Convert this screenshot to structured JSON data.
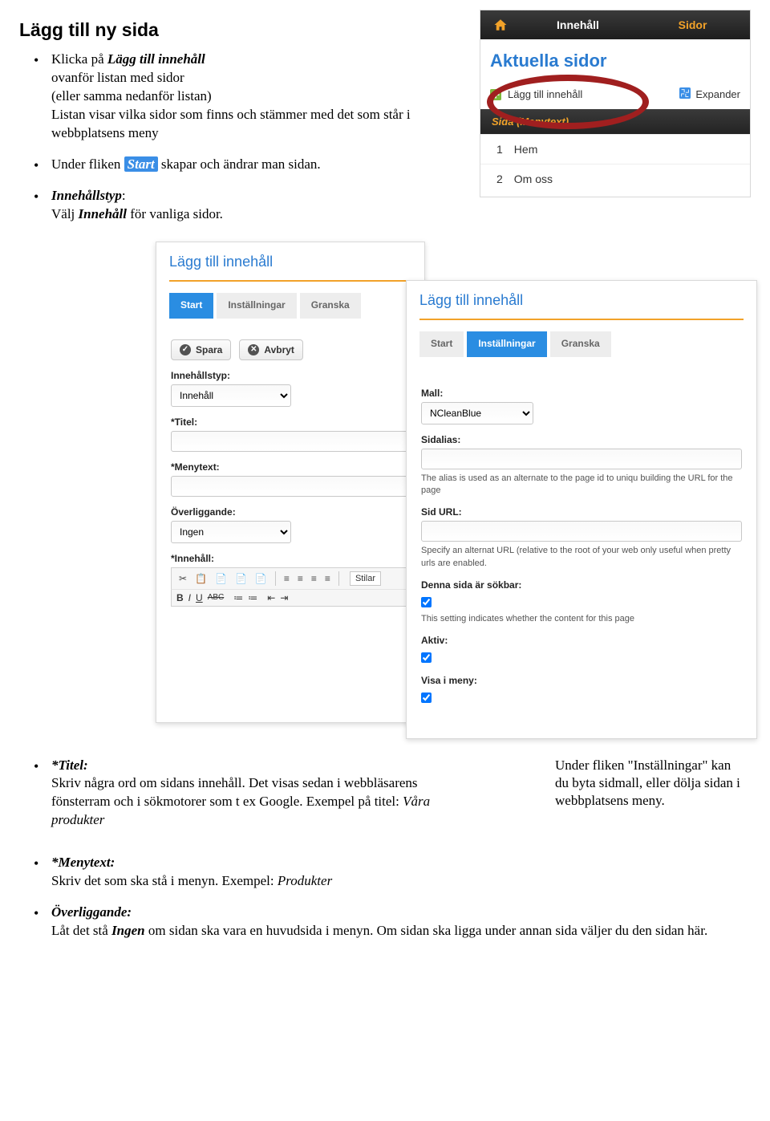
{
  "page_title": "Lägg till ny sida",
  "bullet1": {
    "lead_prefix": "Klicka på ",
    "lead_bi": "Lägg till innehåll",
    "line2": "ovanför listan med sidor",
    "line3": "(eller samma nedanför listan)",
    "line4": "Listan visar vilka sidor som finns och stämmer med det som står i webbplatsens meny"
  },
  "bullet2": {
    "prefix": "Under fliken ",
    "start": "Start",
    "suffix": " skapar och ändrar man sidan."
  },
  "bullet3": {
    "heading": "Innehållstyp",
    "line_prefix": "Välj ",
    "line_bi": "Innehåll",
    "line_suffix": " för vanliga sidor."
  },
  "nav": {
    "innehall": "Innehåll",
    "sidor": "Sidor",
    "section": "Aktuella sidor",
    "add_link": "Lägg till innehåll",
    "expand": "Expander",
    "dark_row": "Sida (Menytext)",
    "row1_num": "1",
    "row1_label": "Hem",
    "row2_num": "2",
    "row2_label": "Om oss"
  },
  "panel1": {
    "title": "Lägg till innehåll",
    "tab_start": "Start",
    "tab_settings": "Inställningar",
    "tab_review": "Granska",
    "save": "Spara",
    "cancel": "Avbryt",
    "lbl_type": "Innehållstyp:",
    "type_value": "Innehåll",
    "lbl_title": "*Titel:",
    "lbl_menu": "*Menytext:",
    "lbl_parent": "Överliggande:",
    "parent_value": "Ingen",
    "lbl_content": "*Innehåll:",
    "stilar": "Stilar"
  },
  "panel2": {
    "title": "Lägg till innehåll",
    "tab_start": "Start",
    "tab_settings": "Inställningar",
    "tab_review": "Granska",
    "lbl_mall": "Mall:",
    "mall_value": "NCleanBlue",
    "lbl_sidalias": "Sidalias:",
    "alias_help": "The alias is used as an alternate to the page id to uniqu building the URL for the page",
    "lbl_sidurl": "Sid URL:",
    "url_help": "Specify an alternat URL (relative to the root of your web only useful when pretty urls are enabled.",
    "lbl_searchable": "Denna sida är sökbar:",
    "search_help": "This setting indicates whether the content for this page",
    "lbl_active": "Aktiv:",
    "lbl_show": "Visa i meny:"
  },
  "bullet_titel": {
    "heading": "*Titel:",
    "body": "Skriv några ord om sidans innehåll. Det visas sedan i webbläsarens fönsterram och i sökmotorer som t ex Google. Exempel på titel: ",
    "example": "Våra produkter"
  },
  "side_note": "Under fliken \"Inställningar\" kan du byta sidmall, eller dölja sidan i webbplatsens meny.",
  "bullet_menu": {
    "heading": "*Menytext:",
    "body": "Skriv det som ska stå i menyn. Exempel: ",
    "example": "Produkter"
  },
  "bullet_over": {
    "heading": "Överliggande:",
    "body_prefix": "Låt det stå ",
    "ingen": "Ingen",
    "body_suffix": " om sidan ska vara en huvudsida i menyn. Om sidan ska ligga under annan sida väljer du den sidan här."
  }
}
